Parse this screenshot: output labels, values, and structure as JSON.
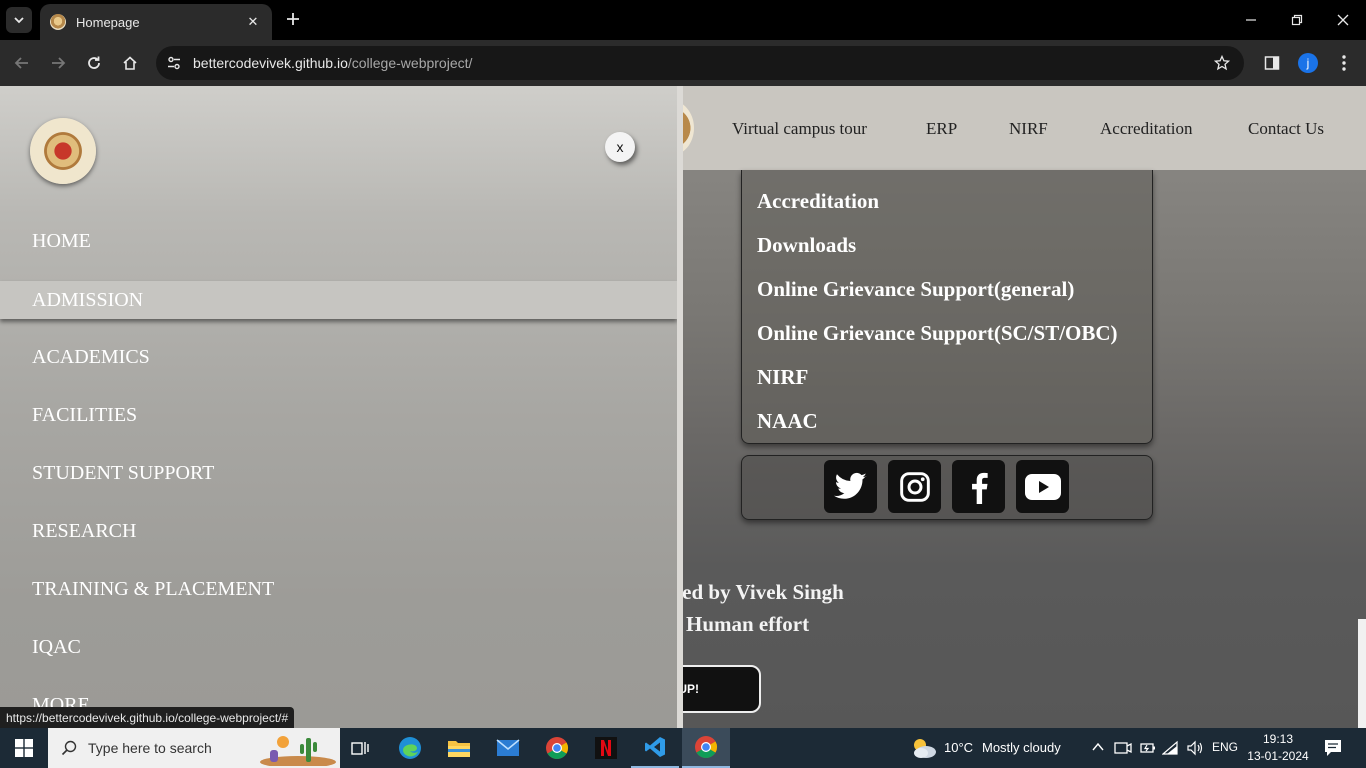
{
  "browser": {
    "tab_title": "Homepage",
    "url_domain": "bettercodevivek.github.io",
    "url_path": "/college-webproject/",
    "profile_initial": "j"
  },
  "header": {
    "nav": [
      "Virtual campus tour",
      "ERP",
      "NIRF",
      "Accreditation",
      "Contact Us"
    ]
  },
  "links_panel": {
    "items": [
      "Accreditation",
      "Downloads",
      "Online Grievance Support(general)",
      "Online Grievance Support(SC/ST/OBC)",
      "NIRF",
      "NAAC"
    ]
  },
  "social": [
    "twitter-icon",
    "instagram-icon",
    "facebook-icon",
    "youtube-icon"
  ],
  "footer": {
    "line1": "oped by Vivek Singh",
    "line2": "Human effort",
    "button": "UP!"
  },
  "side_menu": {
    "close_label": "x",
    "items": [
      "HOME",
      "ADMISSION",
      "ACADEMICS",
      "FACILITIES",
      "STUDENT SUPPORT",
      "RESEARCH",
      "TRAINING & PLACEMENT",
      "IQAC",
      "MORE"
    ],
    "active_item": "ADMISSION"
  },
  "status_bar": {
    "url": "https://bettercodevivek.github.io/college-webproject/#"
  },
  "taskbar": {
    "search_placeholder": "Type here to search",
    "weather_temp": "10°C",
    "weather_text": "Mostly cloudy",
    "language": "ENG",
    "time": "19:13",
    "date": "13-01-2024"
  },
  "colors": {
    "taskbar": "#1c2a36",
    "chrome_toolbar": "#2b2b2b",
    "profile": "#1a73e8",
    "menu_active": "#c6c5c1"
  }
}
